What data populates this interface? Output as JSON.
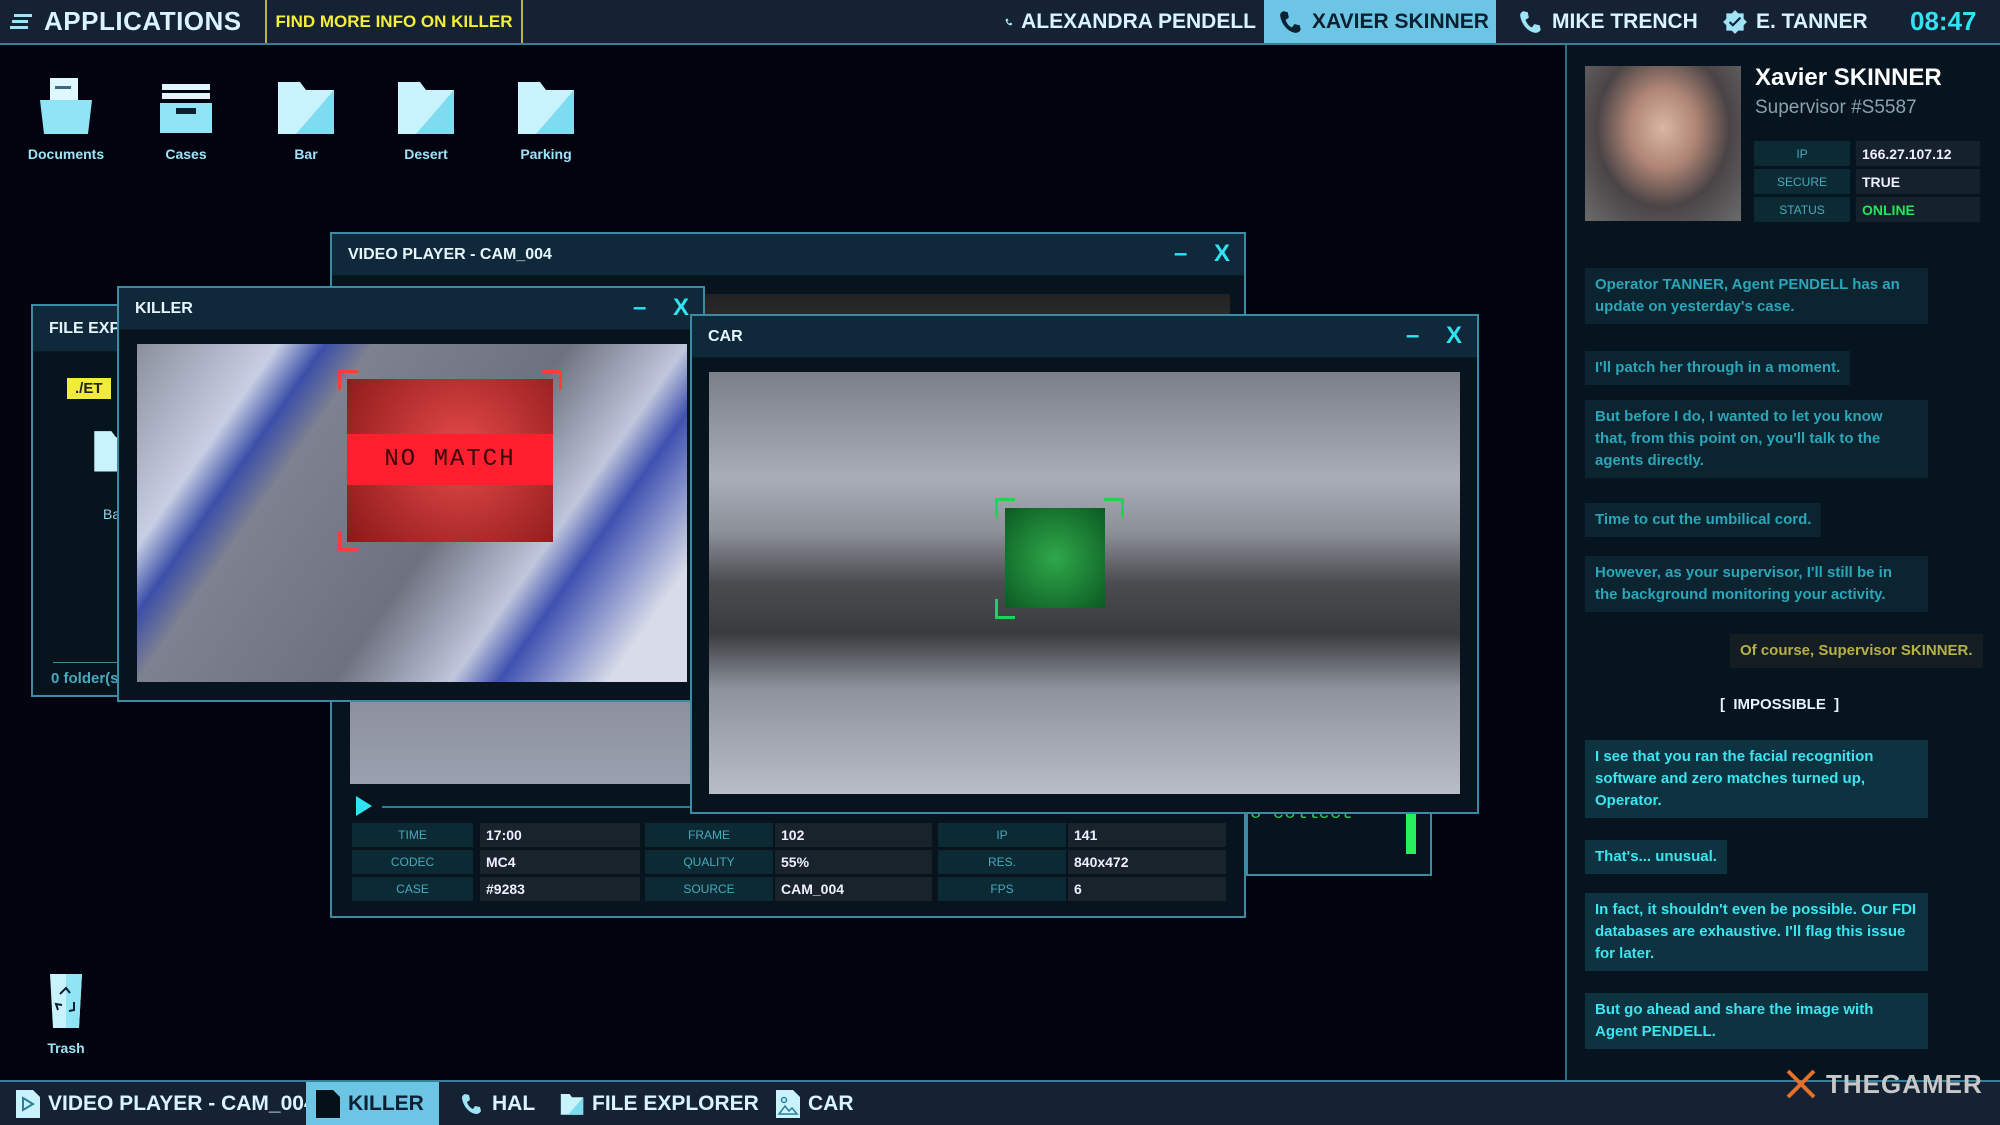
{
  "topbar": {
    "apps_label": "APPLICATIONS",
    "objective": "FIND MORE INFO ON KILLER",
    "contacts": [
      {
        "name": "ALEXANDRA PENDELL",
        "icon": "phone-icon"
      },
      {
        "name": "XAVIER SKINNER",
        "icon": "phone-icon",
        "active": true
      },
      {
        "name": "MIKE TRENCH",
        "icon": "phone-icon"
      },
      {
        "name": "E. TANNER",
        "icon": "verified-badge-icon"
      }
    ],
    "clock": "08:47"
  },
  "desktop": {
    "icons": [
      {
        "label": "Documents",
        "icon": "documents-folder-icon"
      },
      {
        "label": "Cases",
        "icon": "cases-tray-icon"
      },
      {
        "label": "Bar",
        "icon": "folder-icon"
      },
      {
        "label": "Desert",
        "icon": "folder-icon"
      },
      {
        "label": "Parking",
        "icon": "folder-icon"
      }
    ],
    "trash": "Trash"
  },
  "file_explorer": {
    "title": "FILE EXP",
    "path": "./ET",
    "item": "Ba",
    "status": "0 folder(s"
  },
  "video_player": {
    "title": "VIDEO PLAYER - CAM_004",
    "info": [
      [
        "TIME",
        "17:00",
        "FRAME",
        "102",
        "IP",
        "141"
      ],
      [
        "CODEC",
        "MC4",
        "QUALITY",
        "55%",
        "RES.",
        "840x472"
      ],
      [
        "CASE",
        "#9283",
        "SOURCE",
        "CAM_004",
        "FPS",
        "6"
      ]
    ]
  },
  "killer_window": {
    "title": "KILLER",
    "result": "NO MATCH"
  },
  "car_window": {
    "title": "CAR"
  },
  "terminal": {
    "text": "o collect"
  },
  "window_controls": {
    "minimize": "–",
    "close": "X"
  },
  "profile": {
    "name": "Xavier SKINNER",
    "role": "Supervisor #S5587",
    "info": [
      {
        "label": "IP",
        "value": "166.27.107.12"
      },
      {
        "label": "SECURE",
        "value": "TRUE"
      },
      {
        "label": "STATUS",
        "value": "ONLINE"
      }
    ],
    "status_color": "#27e35a"
  },
  "chat": {
    "messages": [
      {
        "text": "Operator TANNER, Agent PENDELL has an update on yesterday's case."
      },
      {
        "text": "I'll patch her through in a moment."
      },
      {
        "text": "But before I do, I wanted to let you know that, from this point on, you'll talk to the agents directly."
      },
      {
        "text": "Time to cut the umbilical cord."
      },
      {
        "text": "However, as your supervisor, I'll still be in the background monitoring your activity."
      },
      {
        "text": "Of course, Supervisor SKINNER."
      },
      {
        "text": "I see that you ran the facial recognition software and zero matches turned up, Operator."
      },
      {
        "text": "That's... unusual."
      },
      {
        "text": "In fact, it shouldn't even be possible. Our FDI databases are exhaustive. I'll flag this issue for later."
      },
      {
        "text": "But go ahead and share the image with Agent PENDELL."
      }
    ],
    "choice": "[  IMPOSSIBLE  ]"
  },
  "taskbar": {
    "items": [
      {
        "label": "VIDEO PLAYER - CAM_004"
      },
      {
        "label": "KILLER",
        "active": true
      },
      {
        "label": "HAL"
      },
      {
        "label": "FILE EXPLORER"
      },
      {
        "label": "CAR"
      }
    ]
  },
  "watermark": "THEGAMER",
  "colors": {
    "accent": "#2fe3f2",
    "objective": "#f3ee3a",
    "no_match": "#ff1f2f",
    "match_box": "#1fd35a",
    "panel": "#142234"
  }
}
